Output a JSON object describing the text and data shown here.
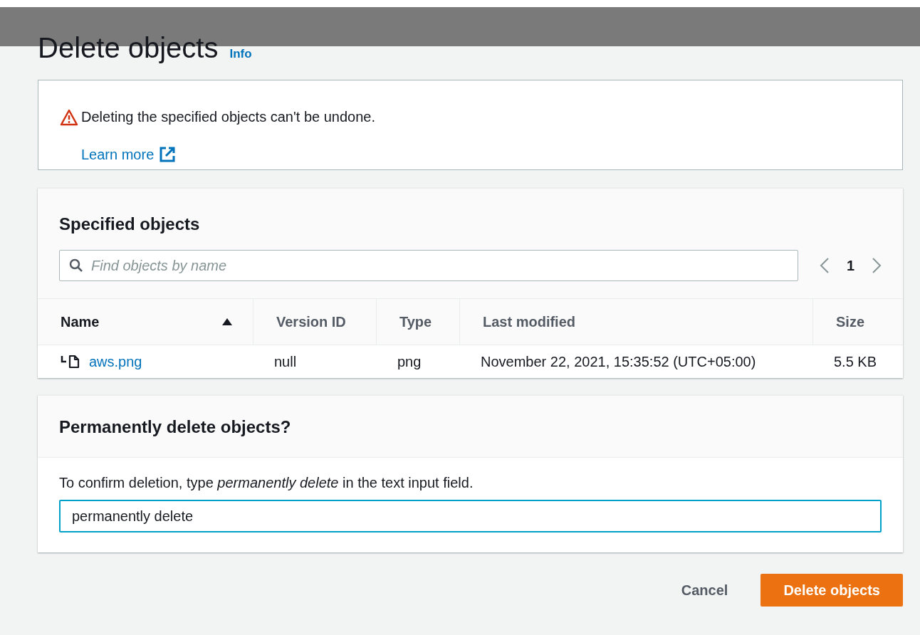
{
  "header": {
    "title": "Delete objects",
    "info_link": "Info"
  },
  "alert": {
    "message": "Deleting the specified objects can't be undone.",
    "link": "Learn more"
  },
  "specified_objects": {
    "heading": "Specified objects",
    "search": {
      "placeholder": "Find objects by name"
    },
    "pagination": {
      "page": "1"
    },
    "columns": [
      {
        "label": "Name",
        "sorted": true
      },
      {
        "label": "Version ID",
        "sorted": false
      },
      {
        "label": "Type",
        "sorted": false
      },
      {
        "label": "Last modified",
        "sorted": false
      },
      {
        "label": "Size",
        "sorted": false
      }
    ],
    "rows": [
      {
        "name": "aws.png",
        "version_id": "null",
        "type": "png",
        "last_modified": "November 22, 2021, 15:35:52 (UTC+05:00)",
        "size": "5.5 KB"
      }
    ]
  },
  "confirm": {
    "heading": "Permanently delete objects?",
    "instruction": "To confirm deletion, type *permanently delete* in the text input field.",
    "value": "permanently delete"
  },
  "buttons": [
    {
      "label": "Cancel",
      "kind": "link"
    },
    {
      "label": "Delete objects",
      "kind": "primary"
    }
  ]
}
